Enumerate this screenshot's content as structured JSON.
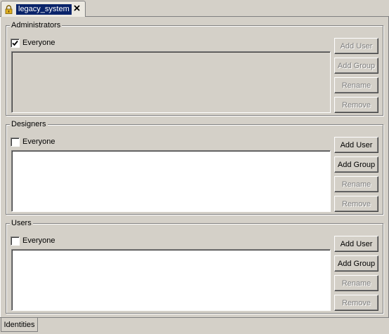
{
  "editor_tab": {
    "title": "legacy_system",
    "lock_icon": "lock-icon",
    "close_icon": "close-icon"
  },
  "groups": [
    {
      "legend": "Administrators",
      "everyone_label": "Everyone",
      "everyone_checked": true,
      "buttons": {
        "add_user": "Add User",
        "add_group": "Add Group",
        "rename": "Rename",
        "remove": "Remove"
      }
    },
    {
      "legend": "Designers",
      "everyone_label": "Everyone",
      "everyone_checked": false,
      "buttons": {
        "add_user": "Add User",
        "add_group": "Add Group",
        "rename": "Rename",
        "remove": "Remove"
      }
    },
    {
      "legend": "Users",
      "everyone_label": "Everyone",
      "everyone_checked": false,
      "buttons": {
        "add_user": "Add User",
        "add_group": "Add Group",
        "rename": "Rename",
        "remove": "Remove"
      }
    }
  ],
  "bottom_tab": {
    "label": "Identities"
  },
  "colors": {
    "selection": "#0a246a",
    "face": "#d4d0c8",
    "disabled_text": "#808080"
  }
}
